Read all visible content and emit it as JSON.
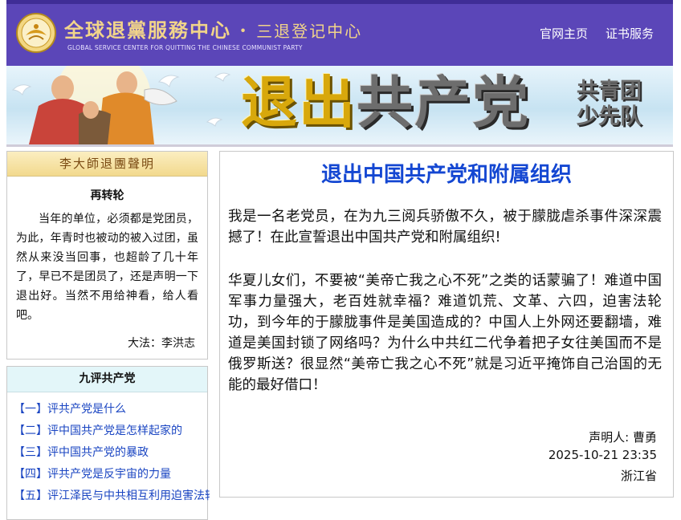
{
  "header": {
    "title_main": "全球退黨服務中心",
    "title_sep": "·",
    "title_sub": "三退登记中心",
    "title_en": "GLOBAL SERVICE CENTER FOR QUITTING THE CHINESE COMMUNIST PARTY",
    "nav": [
      "官网主页",
      "证书服务"
    ]
  },
  "banner": {
    "title_part1": "退出",
    "title_part2": "共产党",
    "side_line1": "共青团",
    "side_line2": "少先队"
  },
  "sidebar_statement": {
    "header": "李大師退團聲明",
    "title": "再转轮",
    "body": "当年的单位，必须都是党团员，为此，年青时也被动的被入过团，虽然从来没当回事，也超龄了几十年了，早已不是团员了，还是声明一下退出好。当然不用给神看，给人看吧。",
    "signature": "大法：李洪志"
  },
  "sidebar_nine": {
    "header": "九评共产党",
    "items": [
      "【一】评共产党是什么",
      "【二】评中国共产党是怎样起家的",
      "【三】评中国共产党的暴政",
      "【四】评共产党是反宇宙的力量",
      "【五】评江泽民与中共相互利用迫害法轮功"
    ]
  },
  "main": {
    "title": "退出中国共产党和附属组织",
    "paragraphs": [
      "我是一名老党员，在为九三阅兵骄傲不久，被于朦胧虐杀事件深深震撼了！在此宣誓退出中国共产党和附属组织!",
      "华夏儿女们，不要被“美帝亡我之心不死”之类的话蒙骗了！难道中国军事力量强大，老百姓就幸福？难道饥荒、文革、六四，迫害法轮功，到今年的于朦胧事件是美国造成的？中国人上外网还要翻墙，难道是美国封锁了网络吗？为什么中共红二代争着把子女往美国而不是俄罗斯送？很显然“美帝亡我之心不死”就是习近平掩饰自己治国的无能的最好借口！"
    ],
    "declarant": "声明人: 曹勇",
    "datetime": "2025-10-21 23:35",
    "province": "浙江省"
  }
}
